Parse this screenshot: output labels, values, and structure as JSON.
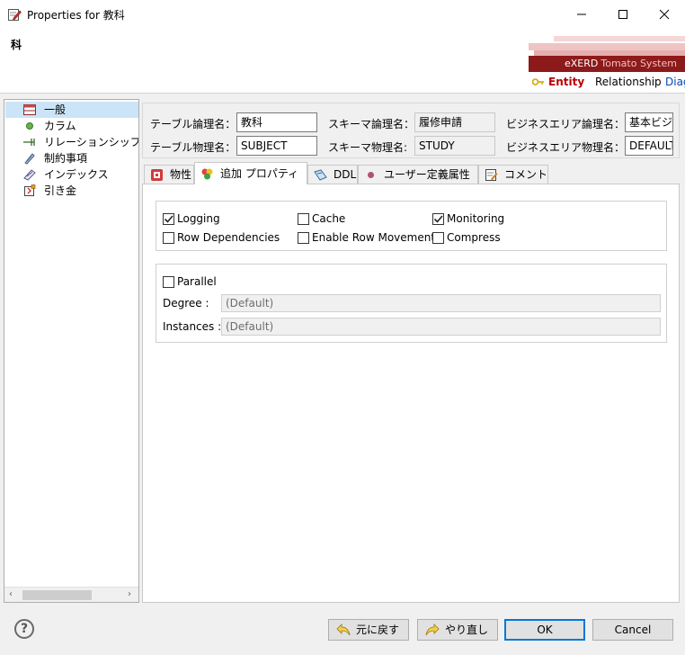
{
  "window": {
    "title": "Properties for 教科",
    "heading": "科"
  },
  "brand": {
    "name": "eXERD",
    "product": "Tomato System",
    "tabs": [
      "Entity",
      "Relationship",
      "Diag"
    ]
  },
  "nav": {
    "items": [
      {
        "label": "一般",
        "icon": "table-icon"
      },
      {
        "label": "カラム",
        "icon": "column-dot-icon"
      },
      {
        "label": "リレーションシップ",
        "icon": "relationship-arrow-icon"
      },
      {
        "label": "制約事項",
        "icon": "constraint-icon"
      },
      {
        "label": "インデックス",
        "icon": "index-icon"
      },
      {
        "label": "引き金",
        "icon": "trigger-icon"
      }
    ]
  },
  "fields": {
    "table_logical_label": "テーブル論理名：",
    "table_logical_value": "教科",
    "table_physical_label": "テーブル物理名：",
    "table_physical_value": "SUBJECT",
    "schema_logical_label": "スキーマ論理名：",
    "schema_logical_value": "履修申請",
    "schema_physical_label": "スキーマ物理名:",
    "schema_physical_value": "STUDY",
    "biz_logical_label": "ビジネスエリア論理名：",
    "biz_logical_value": "基本ビジ",
    "biz_physical_label": "ビジネスエリア物理名：",
    "biz_physical_value": "DEFAULT"
  },
  "tabs": [
    {
      "label": "物性",
      "icon": "property-icon"
    },
    {
      "label": "追加 プロパティ",
      "icon": "additional-property-icon"
    },
    {
      "label": "DDL",
      "icon": "ddl-icon"
    },
    {
      "label": "ユーザー定義属性",
      "icon": "user-attribute-icon"
    },
    {
      "label": "コメント",
      "icon": "comment-icon"
    }
  ],
  "active_tab": "追加 プロパティ",
  "options": {
    "logging": {
      "label": "Logging",
      "checked": true
    },
    "cache": {
      "label": "Cache",
      "checked": false
    },
    "monitoring": {
      "label": "Monitoring",
      "checked": true
    },
    "row_dependencies": {
      "label": "Row Dependencies",
      "checked": false
    },
    "enable_row_movement": {
      "label": "Enable Row Movement",
      "checked": false
    },
    "compress": {
      "label": "Compress",
      "checked": false
    }
  },
  "parallel": {
    "label": "Parallel",
    "checked": false,
    "degree_label": "Degree :",
    "degree_value": "(Default)",
    "instances_label": "Instances :",
    "instances_value": "(Default)"
  },
  "buttons": {
    "undo": "元に戻す",
    "redo": "やり直し",
    "ok": "OK",
    "cancel": "Cancel",
    "help": "?"
  },
  "colors": {
    "brand": "#8d1a1a",
    "selection": "#cce4f7",
    "focus": "#0078d7"
  }
}
